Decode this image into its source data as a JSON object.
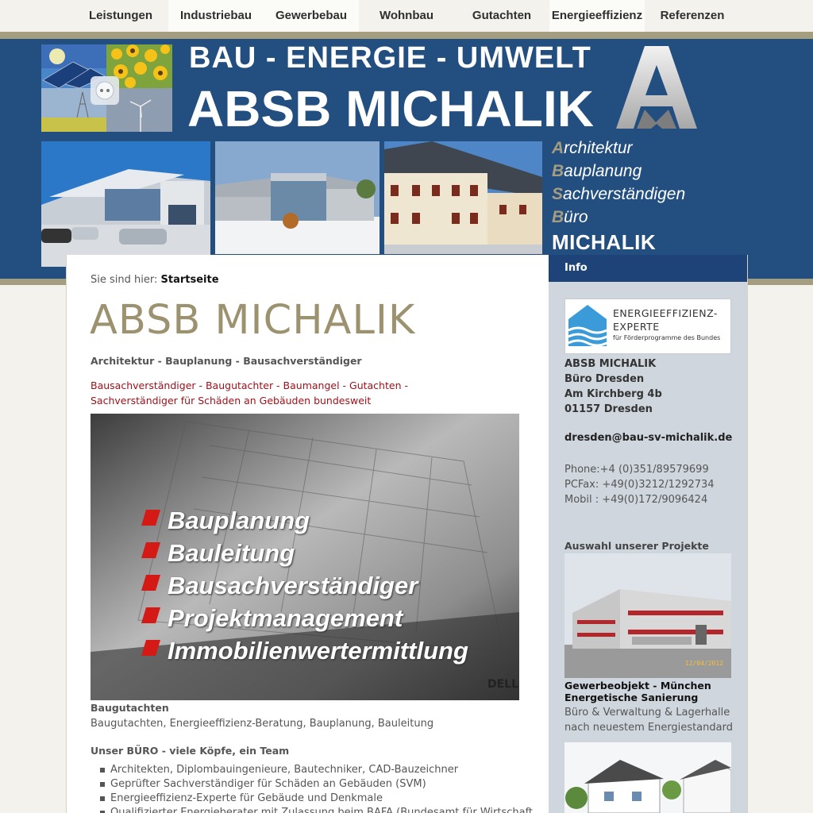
{
  "nav": [
    {
      "label": "Leistungen"
    },
    {
      "label": "Industriebau"
    },
    {
      "label": "Gewerbebau"
    },
    {
      "label": "Wohnbau"
    },
    {
      "label": "Gutachten"
    },
    {
      "label": "Energieeffizienz"
    },
    {
      "label": "Referenzen"
    }
  ],
  "header": {
    "line1": "BAU - ENERGIE - UMWELT",
    "line2": "ABSB MICHALIK",
    "tagline": [
      {
        "first": "A",
        "rest": "rchitektur"
      },
      {
        "first": "B",
        "rest": "auplanung"
      },
      {
        "first": "S",
        "rest": "achverständigen"
      },
      {
        "first": "B",
        "rest": "üro"
      }
    ],
    "brand": "MICHALIK",
    "collage_icon": "sun-energy-collage",
    "colors": {
      "blue": "#234e80",
      "gold": "#a59d80",
      "navy": "#1e4378",
      "red": "#a0111a"
    }
  },
  "breadcrumb": {
    "prefix": "Sie sind hier:",
    "current": "Startseite"
  },
  "main": {
    "title": "ABSB MICHALIK",
    "subtitle": "Architektur - Bauplanung - Bausachverständiger",
    "red_line1": "Bausachverständiger - Baugutachter - Baumangel - Gutachten -",
    "red_line2": "Sachverständiger für Schäden an Gebäuden bundesweit",
    "hero_items": [
      "Bauplanung",
      "Bauleitung",
      "Bausachverständiger",
      "Projektmanagement",
      "Immobilienwertermittlung"
    ],
    "caption_head": "Baugutachten",
    "caption_text": "Baugutachten, Energieeffizienz-Beratung, Bauplanung, Bauleitung",
    "team_head": "Unser BÜRO - viele Köpfe, ein Team",
    "team": [
      "Architekten, Diplombauingenieure, Bautechniker, CAD-Bauzeichner",
      "Geprüfter Sachverständiger für Schäden an Gebäuden (SVM)",
      "Energieeffizienz-Experte für Gebäude und Denkmale",
      "Qualifizierter Energieberater mit Zulassung beim BAFA (Bundesamt für Wirtschaft"
    ]
  },
  "side": {
    "head": "Info",
    "expert_l1": "ENERGIEEFFIZIENZ-",
    "expert_l2": "EXPERTE",
    "expert_l3": "für Förderprogramme des Bundes",
    "addr": [
      "ABSB MICHALIK",
      "Büro Dresden",
      "Am Kirchberg 4b",
      "01157 Dresden"
    ],
    "email": "dresden@bau-sv-michalik.de",
    "phones": [
      "Phone:+4 (0)351/89579699",
      "PCFax: +49(0)3212/1292734",
      "Mobil : +49(0)172/9096424"
    ],
    "proj_head": "Auswahl unserer Projekte",
    "proj_date": "12/04/2012",
    "proj_title1": "Gewerbeobjekt - München",
    "proj_title2": "Energetische Sanierung",
    "proj_desc1": "Büro & Verwaltung & Lagerhalle",
    "proj_desc2": "nach neuestem Energiestandard"
  }
}
